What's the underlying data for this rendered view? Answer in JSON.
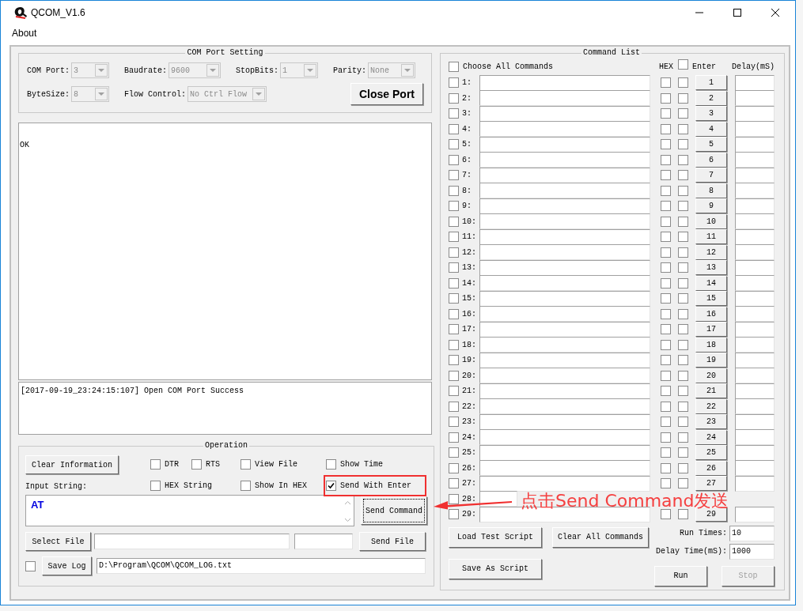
{
  "window": {
    "title": "QCOM_V1.6",
    "menu": [
      "About"
    ]
  },
  "com_port_setting": {
    "title": "COM Port Setting",
    "fields": [
      {
        "label": "COM Port:",
        "value": "3"
      },
      {
        "label": "Baudrate:",
        "value": "9600"
      },
      {
        "label": "StopBits:",
        "value": "1"
      },
      {
        "label": "Parity:",
        "value": "None"
      },
      {
        "label": "ByteSize:",
        "value": "8"
      },
      {
        "label": "Flow Control:",
        "value": "No Ctrl Flow"
      }
    ],
    "button": "Close Port"
  },
  "receive_area": {
    "text": "OK"
  },
  "log_area": {
    "text": "[2017-09-19_23:24:15:107] Open COM Port Success"
  },
  "operation": {
    "title": "Operation",
    "clear_button": "Clear Information",
    "checkboxes": [
      {
        "label": "DTR",
        "checked": false
      },
      {
        "label": "RTS",
        "checked": false
      },
      {
        "label": "View File",
        "checked": false
      },
      {
        "label": "Show Time",
        "checked": false
      },
      {
        "label": "HEX String",
        "checked": false
      },
      {
        "label": "Show In HEX",
        "checked": false
      },
      {
        "label": "Send With Enter",
        "checked": true
      }
    ],
    "input_label": "Input String:",
    "input_value": "AT",
    "send_button": "Send Command",
    "select_file_button": "Select File",
    "send_file_button": "Send File",
    "save_log_checked": false,
    "save_log_button": "Save Log",
    "log_path": "D:\\Program\\QCOM\\QCOM_LOG.txt"
  },
  "command_list": {
    "title": "Command List",
    "choose_all": {
      "label": "Choose All Commands",
      "checked": false
    },
    "hex_header": "HEX",
    "enter_header": {
      "label": "Enter",
      "checked": false
    },
    "delay_header": "Delay(mS)",
    "rows": [
      {
        "number": "1:",
        "checked": false,
        "hex": false,
        "enter": false,
        "button": "1"
      },
      {
        "number": "2:",
        "checked": false,
        "hex": false,
        "enter": false,
        "button": "2"
      },
      {
        "number": "3:",
        "checked": false,
        "hex": false,
        "enter": false,
        "button": "3"
      },
      {
        "number": "4:",
        "checked": false,
        "hex": false,
        "enter": false,
        "button": "4"
      },
      {
        "number": "5:",
        "checked": false,
        "hex": false,
        "enter": false,
        "button": "5"
      },
      {
        "number": "6:",
        "checked": false,
        "hex": false,
        "enter": false,
        "button": "6"
      },
      {
        "number": "7:",
        "checked": false,
        "hex": false,
        "enter": false,
        "button": "7"
      },
      {
        "number": "8:",
        "checked": false,
        "hex": false,
        "enter": false,
        "button": "8"
      },
      {
        "number": "9:",
        "checked": false,
        "hex": false,
        "enter": false,
        "button": "9"
      },
      {
        "number": "10:",
        "checked": false,
        "hex": false,
        "enter": false,
        "button": "10"
      },
      {
        "number": "11:",
        "checked": false,
        "hex": false,
        "enter": false,
        "button": "11"
      },
      {
        "number": "12:",
        "checked": false,
        "hex": false,
        "enter": false,
        "button": "12"
      },
      {
        "number": "13:",
        "checked": false,
        "hex": false,
        "enter": false,
        "button": "13"
      },
      {
        "number": "14:",
        "checked": false,
        "hex": false,
        "enter": false,
        "button": "14"
      },
      {
        "number": "15:",
        "checked": false,
        "hex": false,
        "enter": false,
        "button": "15"
      },
      {
        "number": "16:",
        "checked": false,
        "hex": false,
        "enter": false,
        "button": "16"
      },
      {
        "number": "17:",
        "checked": false,
        "hex": false,
        "enter": false,
        "button": "17"
      },
      {
        "number": "18:",
        "checked": false,
        "hex": false,
        "enter": false,
        "button": "18"
      },
      {
        "number": "19:",
        "checked": false,
        "hex": false,
        "enter": false,
        "button": "19"
      },
      {
        "number": "20:",
        "checked": false,
        "hex": false,
        "enter": false,
        "button": "20"
      },
      {
        "number": "21:",
        "checked": false,
        "hex": false,
        "enter": false,
        "button": "21"
      },
      {
        "number": "22:",
        "checked": false,
        "hex": false,
        "enter": false,
        "button": "22"
      },
      {
        "number": "23:",
        "checked": false,
        "hex": false,
        "enter": false,
        "button": "23"
      },
      {
        "number": "24:",
        "checked": false,
        "hex": false,
        "enter": false,
        "button": "24"
      },
      {
        "number": "25:",
        "checked": false,
        "hex": false,
        "enter": false,
        "button": "25"
      },
      {
        "number": "26:",
        "checked": false,
        "hex": false,
        "enter": false,
        "button": "26"
      },
      {
        "number": "27:",
        "checked": false,
        "hex": false,
        "enter": false,
        "button": "27"
      },
      {
        "number": "28:",
        "checked": false
      },
      {
        "number": "29:",
        "checked": false,
        "hex": false,
        "enter": false,
        "button": "29"
      }
    ],
    "load_button": "Load Test Script",
    "clear_button": "Clear All Commands",
    "save_button": "Save As Script",
    "run_times_label": "Run Times:",
    "run_times": "10",
    "delay_time_label": "Delay Time(mS):",
    "delay_time": "1000",
    "run_button": "Run",
    "stop_button": {
      "label": "Stop",
      "disabled": true
    }
  },
  "annotation": {
    "text": "点击Send Command发送"
  }
}
